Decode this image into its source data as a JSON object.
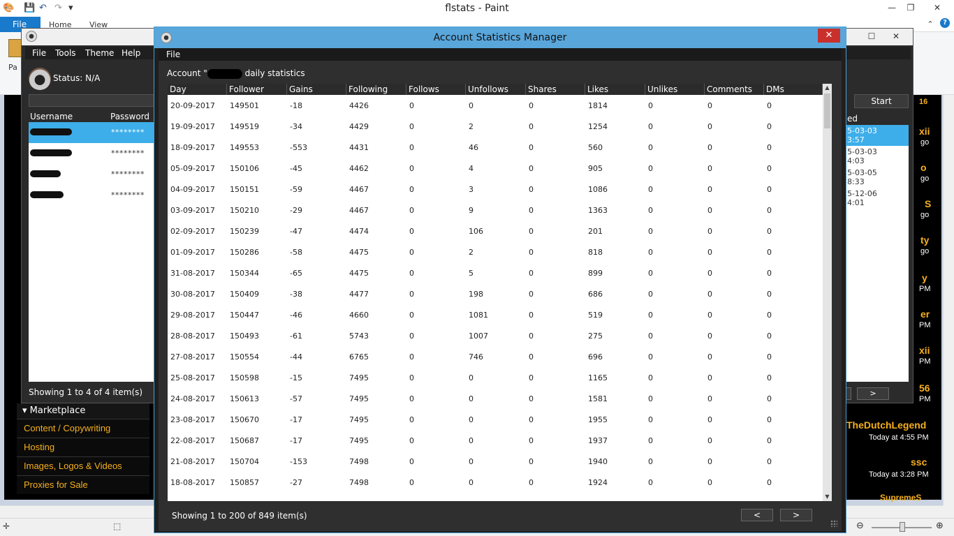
{
  "paint": {
    "title": "flstats - Paint",
    "tabs": [
      "File",
      "Home",
      "View"
    ],
    "paste_label": "Pa",
    "help": "?"
  },
  "website": {
    "marketplace_header": "Marketplace",
    "marketplace_items": [
      "Content / Copywriting",
      "Hosting",
      "Images, Logos & Videos",
      "Proxies for Sale"
    ],
    "right_names": [
      "16",
      "xii",
      "go",
      "o",
      "go",
      "S",
      "go",
      "ty",
      "go",
      "y",
      "PM",
      "er",
      "PM",
      "xii",
      "PM",
      "56",
      "PM",
      "TheDutchLegend",
      "ssc",
      "SupremeS"
    ],
    "right_dates": [
      "Today at 4:55 PM",
      "Today at 3:28 PM"
    ]
  },
  "flapp": {
    "menu": [
      "File",
      "Tools",
      "Theme",
      "Help"
    ],
    "status": "Status: N/A",
    "columns": [
      "Username",
      "Password"
    ],
    "accounts": [
      {
        "password": "********",
        "selected": true
      },
      {
        "password": "********",
        "selected": false
      },
      {
        "password": "********",
        "selected": false
      },
      {
        "password": "********",
        "selected": false
      }
    ],
    "footer": "Showing 1 to 4 of 4 item(s)",
    "start_label": "Start",
    "right_header": "ed",
    "right_rows": [
      {
        "line1": "5-03-03",
        "line2": "3:57"
      },
      {
        "line1": "5-03-03",
        "line2": "4:03"
      },
      {
        "line1": "5-03-05",
        "line2": "8:33"
      },
      {
        "line1": "5-12-06",
        "line2": "4:01"
      }
    ],
    "next_label": ">"
  },
  "asm": {
    "title": "Account Statistics Manager",
    "close": "✕",
    "menu_file": "File",
    "account_prefix": "Account \"",
    "account_suffix": "daily statistics",
    "columns": [
      "Day",
      "Follower",
      "Gains",
      "Following",
      "Follows",
      "Unfollows",
      "Shares",
      "Likes",
      "Unlikes",
      "Comments",
      "DMs"
    ],
    "rows": [
      [
        "20-09-2017",
        "149501",
        "-18",
        "4426",
        "0",
        "0",
        "0",
        "1814",
        "0",
        "0",
        "0"
      ],
      [
        "19-09-2017",
        "149519",
        "-34",
        "4429",
        "0",
        "2",
        "0",
        "1254",
        "0",
        "0",
        "0"
      ],
      [
        "18-09-2017",
        "149553",
        "-553",
        "4431",
        "0",
        "46",
        "0",
        "560",
        "0",
        "0",
        "0"
      ],
      [
        "05-09-2017",
        "150106",
        "-45",
        "4462",
        "0",
        "4",
        "0",
        "905",
        "0",
        "0",
        "0"
      ],
      [
        "04-09-2017",
        "150151",
        "-59",
        "4467",
        "0",
        "3",
        "0",
        "1086",
        "0",
        "0",
        "0"
      ],
      [
        "03-09-2017",
        "150210",
        "-29",
        "4467",
        "0",
        "9",
        "0",
        "1363",
        "0",
        "0",
        "0"
      ],
      [
        "02-09-2017",
        "150239",
        "-47",
        "4474",
        "0",
        "106",
        "0",
        "201",
        "0",
        "0",
        "0"
      ],
      [
        "01-09-2017",
        "150286",
        "-58",
        "4475",
        "0",
        "2",
        "0",
        "818",
        "0",
        "0",
        "0"
      ],
      [
        "31-08-2017",
        "150344",
        "-65",
        "4475",
        "0",
        "5",
        "0",
        "899",
        "0",
        "0",
        "0"
      ],
      [
        "30-08-2017",
        "150409",
        "-38",
        "4477",
        "0",
        "198",
        "0",
        "686",
        "0",
        "0",
        "0"
      ],
      [
        "29-08-2017",
        "150447",
        "-46",
        "4660",
        "0",
        "1081",
        "0",
        "519",
        "0",
        "0",
        "0"
      ],
      [
        "28-08-2017",
        "150493",
        "-61",
        "5743",
        "0",
        "1007",
        "0",
        "275",
        "0",
        "0",
        "0"
      ],
      [
        "27-08-2017",
        "150554",
        "-44",
        "6765",
        "0",
        "746",
        "0",
        "696",
        "0",
        "0",
        "0"
      ],
      [
        "25-08-2017",
        "150598",
        "-15",
        "7495",
        "0",
        "0",
        "0",
        "1165",
        "0",
        "0",
        "0"
      ],
      [
        "24-08-2017",
        "150613",
        "-57",
        "7495",
        "0",
        "0",
        "0",
        "1581",
        "0",
        "0",
        "0"
      ],
      [
        "23-08-2017",
        "150670",
        "-17",
        "7495",
        "0",
        "0",
        "0",
        "1955",
        "0",
        "0",
        "0"
      ],
      [
        "22-08-2017",
        "150687",
        "-17",
        "7495",
        "0",
        "0",
        "0",
        "1937",
        "0",
        "0",
        "0"
      ],
      [
        "21-08-2017",
        "150704",
        "-153",
        "7498",
        "0",
        "0",
        "0",
        "1940",
        "0",
        "0",
        "0"
      ],
      [
        "18-08-2017",
        "150857",
        "-27",
        "7498",
        "0",
        "0",
        "0",
        "1924",
        "0",
        "0",
        "0"
      ]
    ],
    "footer": "Showing 1 to 200 of 849 item(s)",
    "prev_label": "<",
    "next_label": ">"
  }
}
